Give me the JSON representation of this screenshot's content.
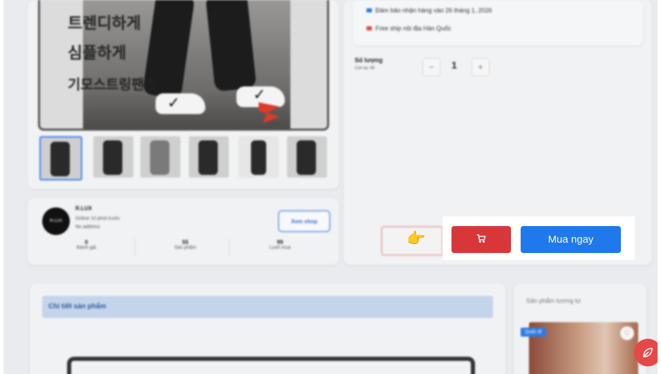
{
  "product": {
    "image_text": [
      "트렌디하게",
      "심플하게",
      "기모스트링팬츠"
    ],
    "thumbnail_count": 6
  },
  "shop": {
    "name": "R.LUX",
    "avatar_text": "R-LUX",
    "online": "Online 10 phút trước",
    "address": "No address",
    "view_button": "Xem shop",
    "stats": [
      {
        "value": "0",
        "label": "Đánh giá"
      },
      {
        "value": "55",
        "label": "Sản phẩm"
      },
      {
        "value": "99",
        "label": "Lượt mua"
      }
    ]
  },
  "shipping": {
    "guarantee": "Đảm bảo nhận hàng vào 26 tháng 1, 2026",
    "free_ship": "Free ship nội địa Hàn Quốc",
    "guarantee_color": "#2e7be2",
    "free_ship_color": "#e04b4b"
  },
  "quantity": {
    "label": "Số lượng",
    "remaining": "Còn lại: 49",
    "value": "1",
    "minus": "−",
    "plus": "+"
  },
  "actions": {
    "buy_now": "Mua ngay",
    "cart_icon": "shopping-cart-icon",
    "cart_color": "#d8373a",
    "buy_color": "#1f78ec"
  },
  "pointer_icon": "👉",
  "details": {
    "title": "Chi tiết sản phẩm"
  },
  "similar": {
    "title": "Sản phẩm tương tự",
    "badge": "Quốc tế"
  }
}
